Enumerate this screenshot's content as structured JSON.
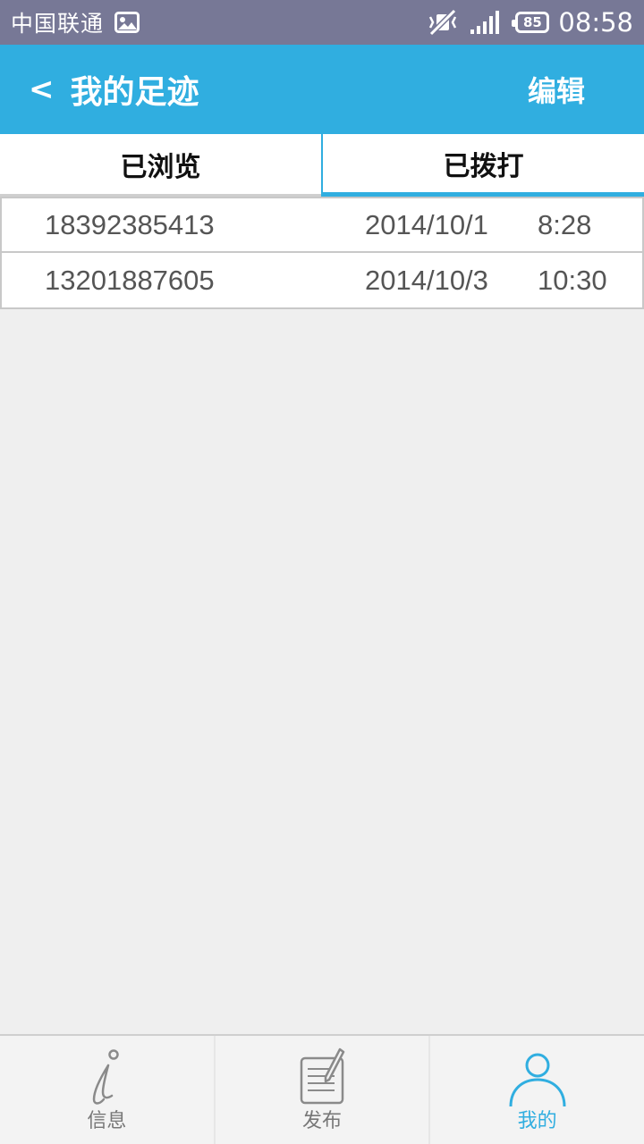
{
  "status_bar": {
    "carrier": "中国联通",
    "battery": "85",
    "time": "08:58"
  },
  "header": {
    "back_symbol": "<",
    "title": "我的足迹",
    "edit_label": "编辑"
  },
  "tabs": [
    {
      "label": "已浏览",
      "selected": false
    },
    {
      "label": "已拨打",
      "selected": true
    }
  ],
  "calls": [
    {
      "number": "18392385413",
      "date": "2014/10/1",
      "time": "8:28"
    },
    {
      "number": "13201887605",
      "date": "2014/10/3",
      "time": "10:30"
    }
  ],
  "bottom_nav": {
    "items": [
      {
        "label": "信息",
        "icon": "info-icon",
        "active": false
      },
      {
        "label": "发布",
        "icon": "publish-icon",
        "active": false
      },
      {
        "label": "我的",
        "icon": "profile-icon",
        "active": true
      }
    ]
  },
  "colors": {
    "status_bar": "#777896",
    "accent": "#30aee0",
    "background": "#efefef",
    "text_muted": "#555555"
  }
}
